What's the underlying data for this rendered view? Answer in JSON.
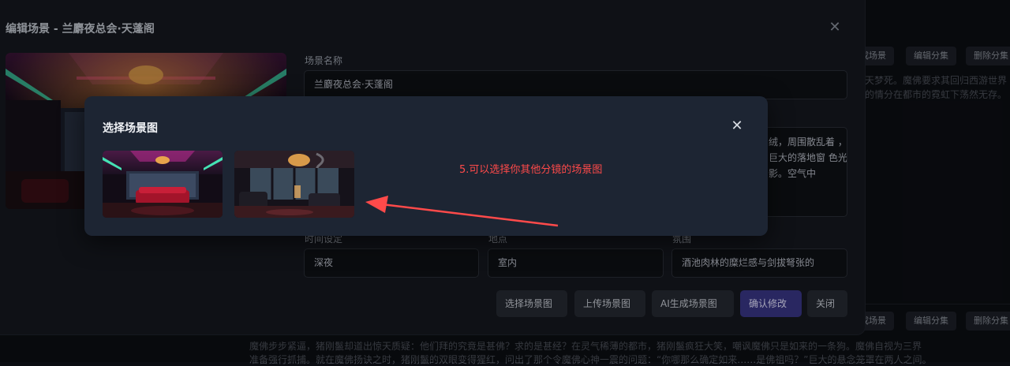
{
  "background": {
    "row1_buttons": [
      "成场景",
      "编辑分集",
      "删除分集"
    ],
    "row2_buttons": [
      "成场景",
      "编辑分集",
      "删除分集"
    ],
    "text_line1": "天梦死。魔佛要求其回归西游世界",
    "text_line2": "的情分在都市的霓虹下荡然无存。",
    "text_line3": "魔佛步步紧逼，猪刚鬣却道出惊天质疑：他们拜的究竟是甚佛？求的是甚经？在灵气稀薄的都市，猪刚鬣疯狂大笑，嘲讽魔佛只是如来的一条狗。魔佛自视为三界",
    "text_line4": "准备强行抓捕。就在魔佛扬诀之时，猪刚鬣的双眼变得猩红，问出了那个令魔佛心神一震的问题：“你哪那么确定如来……是佛祖吗？”巨大的悬念笼罩在两人之间。"
  },
  "dialog": {
    "title": "编辑场景 - 兰麝夜总会·天蓬阁",
    "fields": {
      "name_label": "场景名称",
      "name_value": "兰麝夜总会·天蓬阁",
      "desc_value": "绒，周围散乱着 ，巨大的落地窗 色光影。空气中",
      "time_label": "时间设定",
      "time_value": "深夜",
      "place_label": "地点",
      "place_value": "室内",
      "mood_label": "氛围",
      "mood_value": "酒池肉林的糜烂感与剑拔弩张的"
    },
    "actions": {
      "select": "选择场景图",
      "upload": "上传场景图",
      "ai": "AI生成场景图",
      "confirm": "确认修改",
      "close": "关闭"
    }
  },
  "modal": {
    "title": "选择场景图",
    "annotation": "5.可以选择你其他分镜的场景图",
    "thumbnails": [
      "nightclub-room-red-sofa",
      "nightclub-room-rainy-window"
    ]
  },
  "colors": {
    "accent": "#3a3687",
    "annotation": "#ff4a4a",
    "modal_bg": "#1d2533"
  }
}
